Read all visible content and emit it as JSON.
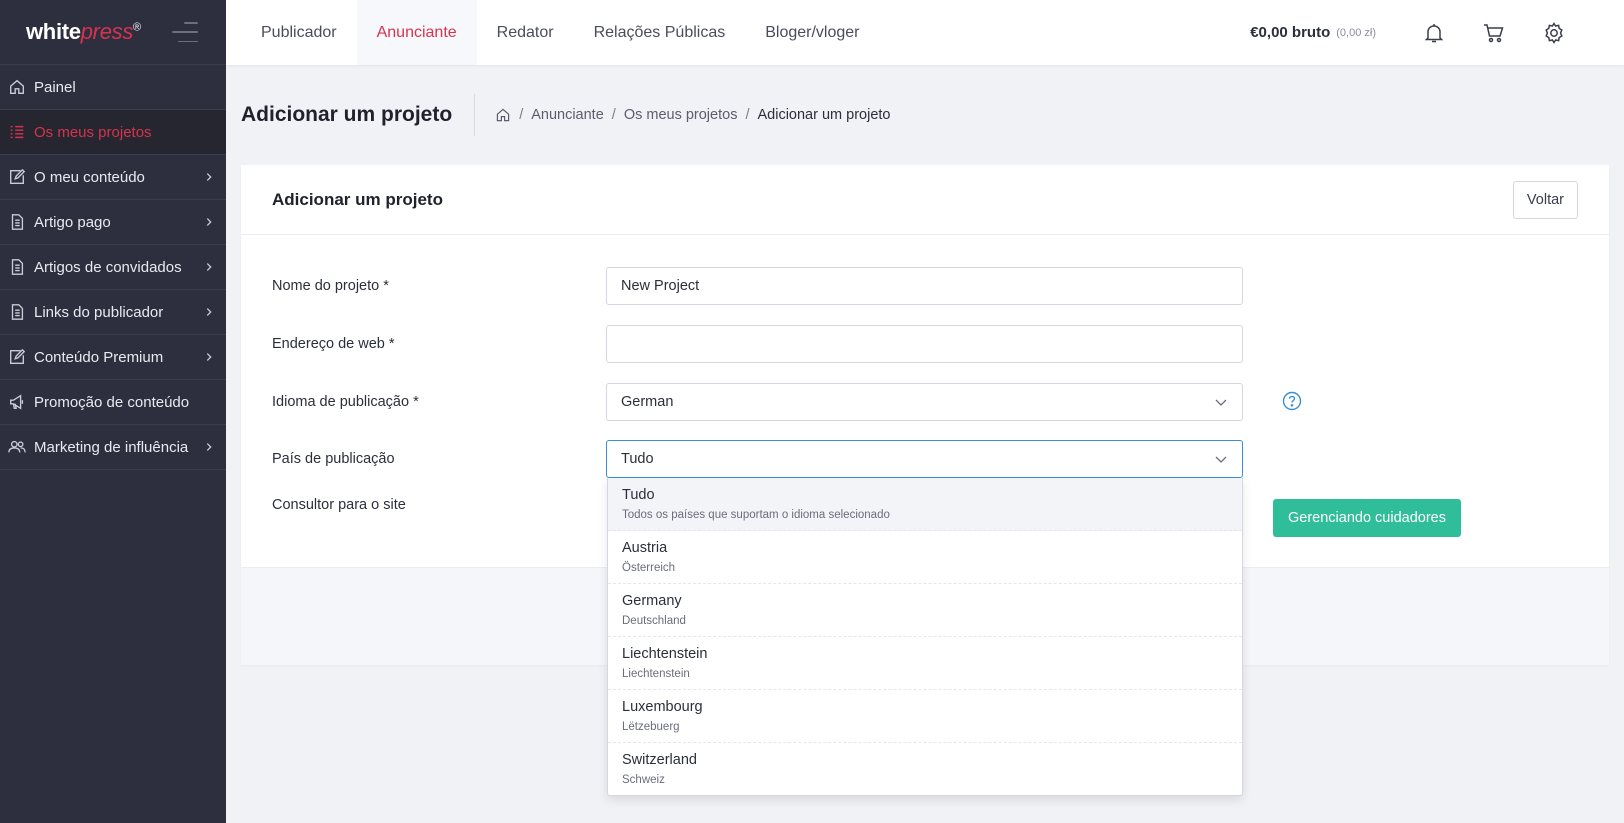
{
  "sidebar": {
    "logo_a": "white",
    "logo_b": "press",
    "logo_reg": "®",
    "items": [
      {
        "label": "Painel",
        "icon": "home-icon",
        "active": false,
        "has_children": false
      },
      {
        "label": "Os meus projetos",
        "icon": "list-icon",
        "active": true,
        "has_children": false
      },
      {
        "label": "O meu conteúdo",
        "icon": "edit-icon",
        "active": false,
        "has_children": true
      },
      {
        "label": "Artigo pago",
        "icon": "document-icon",
        "active": false,
        "has_children": true
      },
      {
        "label": "Artigos de convidados",
        "icon": "document-icon",
        "active": false,
        "has_children": true
      },
      {
        "label": "Links do publicador",
        "icon": "document-icon",
        "active": false,
        "has_children": true
      },
      {
        "label": "Conteúdo Premium",
        "icon": "edit-icon",
        "active": false,
        "has_children": true
      },
      {
        "label": "Promoção de conteúdo",
        "icon": "megaphone-icon",
        "active": false,
        "has_children": false
      },
      {
        "label": "Marketing de influência",
        "icon": "users-icon",
        "active": false,
        "has_children": true
      }
    ]
  },
  "topbar": {
    "tabs": [
      {
        "label": "Publicador",
        "active": false
      },
      {
        "label": "Anunciante",
        "active": true
      },
      {
        "label": "Redator",
        "active": false
      },
      {
        "label": "Relações Públicas",
        "active": false
      },
      {
        "label": "Bloger/vloger",
        "active": false
      }
    ],
    "balance": "€0,00 bruto",
    "balance_sub": "(0,00 zł)",
    "icons": [
      "bell-icon",
      "cart-icon",
      "gear-icon"
    ]
  },
  "page": {
    "title": "Adicionar um projeto",
    "breadcrumb": [
      "Anunciante",
      "Os meus projetos",
      "Adicionar um projeto"
    ],
    "breadcrumb_sep": "/"
  },
  "card": {
    "title": "Adicionar um projeto",
    "back_label": "Voltar",
    "fields": {
      "name": {
        "label": "Nome do projeto *",
        "value": "New Project"
      },
      "web": {
        "label": "Endereço de web *",
        "value": ""
      },
      "language": {
        "label": "Idioma de publicação *",
        "value": "German"
      },
      "country": {
        "label": "País de publicação",
        "value": "Tudo"
      },
      "consultant": {
        "label": "Consultor para o site"
      }
    },
    "manage_button": "Gerenciando cuidadores"
  },
  "dropdown": {
    "options": [
      {
        "main": "Tudo",
        "sub": "Todos os países que suportam o idioma selecionado",
        "highlight": true
      },
      {
        "main": "Austria",
        "sub": "Österreich",
        "highlight": false
      },
      {
        "main": "Germany",
        "sub": "Deutschland",
        "highlight": false
      },
      {
        "main": "Liechtenstein",
        "sub": "Liechtenstein",
        "highlight": false
      },
      {
        "main": "Luxembourg",
        "sub": "Lëtzebuerg",
        "highlight": false
      },
      {
        "main": "Switzerland",
        "sub": "Schweiz",
        "highlight": false
      }
    ]
  },
  "colors": {
    "accent": "#d6334f",
    "sidebar_bg": "#2d2f3e",
    "success": "#2fbd9a",
    "focus": "#3b8fd1"
  }
}
